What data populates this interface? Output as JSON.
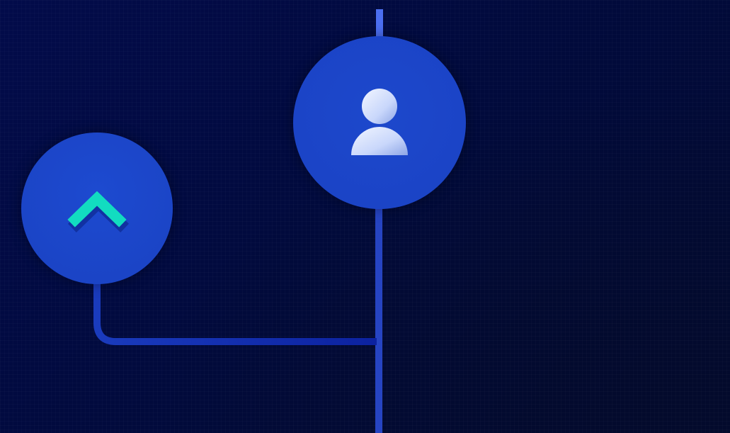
{
  "colors": {
    "background": "#010a3d",
    "node_fill": "#1b45c7",
    "connector_bright": "#4a6ee6",
    "connector_mid": "#2a4ad0",
    "connector_dark": "#0f2aa8",
    "chevron_accent": "#12dcc0",
    "user_icon_light": "#e4ecff",
    "user_icon_shade": "#9db3ea"
  },
  "nodes": [
    {
      "id": "chevron-node",
      "icon": "chevron-up-icon"
    },
    {
      "id": "user-node",
      "icon": "user-icon"
    }
  ]
}
